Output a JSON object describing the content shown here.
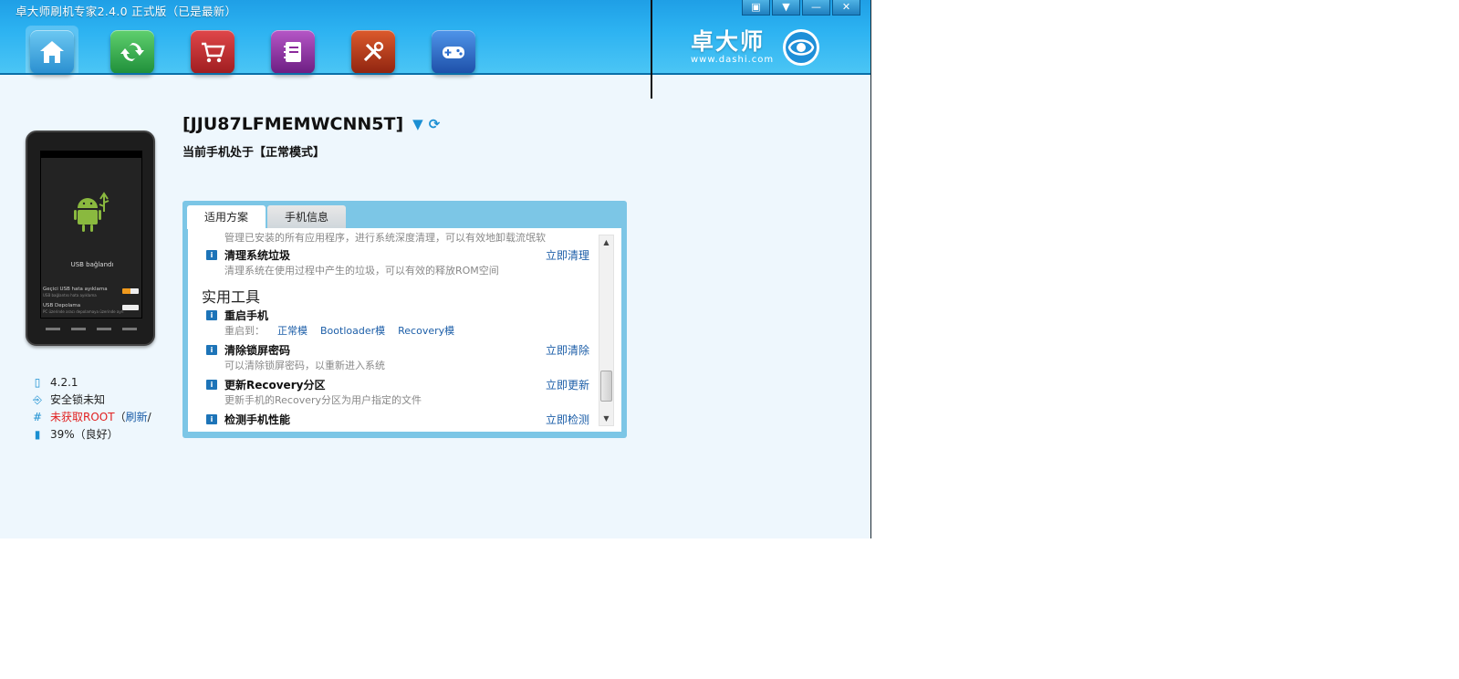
{
  "window": {
    "title": "卓大师刷机专家2.4.0 正式版（已是最新）",
    "controls": [
      "feedback",
      "menu",
      "minimize",
      "close"
    ]
  },
  "nav": {
    "items": [
      {
        "name": "home",
        "color": "#37a6df"
      },
      {
        "name": "refresh",
        "color": "#2fa84a"
      },
      {
        "name": "cart",
        "color": "#c0282b"
      },
      {
        "name": "notebook",
        "color": "#8b2a9b"
      },
      {
        "name": "tools",
        "color": "#b33a1e"
      },
      {
        "name": "game",
        "color": "#2d6fcf"
      }
    ]
  },
  "logo": {
    "cn": "卓大师",
    "url": "www.dashi.com"
  },
  "phone": {
    "usb_label": "USB bağlandı",
    "line1": "Geçici USB hata ayıklama",
    "line1_sub": "USB bağlantısı hata ayıklama",
    "line2": "USB Depolama",
    "line2_sub": "PC üzerinde aracı depolamaya üzerinde ayrı"
  },
  "device": {
    "serial": "[JJU87LFMEMWCNN5T]",
    "mode": "当前手机处于【正常模式】",
    "version": "4.2.1",
    "lock": "安全锁未知",
    "root_status": "未获取ROOT",
    "root_paren_open": "（",
    "root_refresh": "刷新",
    "root_slash": "/",
    "battery": "39%（良好）"
  },
  "tabs": [
    {
      "label": "适用方案",
      "active": true
    },
    {
      "label": "手机信息",
      "active": false
    }
  ],
  "content": {
    "partial_desc": "管理已安装的所有应用程序，进行系统深度清理，可以有效地卸载流氓软",
    "clean": {
      "title": "清理系统垃圾",
      "desc": "清理系统在使用过程中产生的垃圾，可以有效的释放ROM空间",
      "action": "立即清理"
    },
    "tools_section": "实用工具",
    "reboot": {
      "title": "重启手机",
      "prefix": "重启到：",
      "modes": [
        "正常模",
        "Bootloader模",
        "Recovery模"
      ]
    },
    "unlock": {
      "title": "清除锁屏密码",
      "desc": "可以清除锁屏密码，以重新进入系统",
      "action": "立即清除"
    },
    "recovery": {
      "title": "更新Recovery分区",
      "desc": "更新手机的Recovery分区为用户指定的文件",
      "action": "立即更新"
    },
    "perf": {
      "title": "检测手机性能",
      "action": "立即检测"
    }
  }
}
